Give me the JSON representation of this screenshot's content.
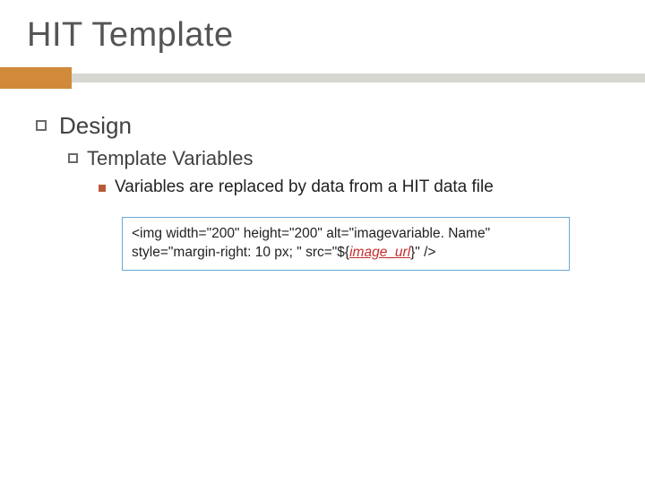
{
  "title": "HIT Template",
  "lvl1": "Design",
  "lvl2": "Template Variables",
  "lvl3": "Variables are replaced by data from a HIT data file",
  "code": {
    "part1": "<img width=\"200\" height=\"200\" alt=\"imagevariable. Name\" style=\"margin-right: 10 px; \" src=\"${",
    "var": "image_url",
    "part2": "}\" />"
  }
}
